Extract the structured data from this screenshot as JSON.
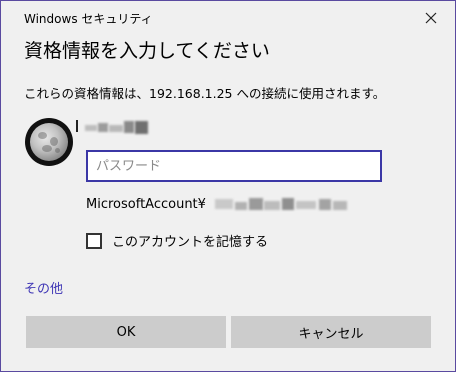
{
  "window": {
    "title": "Windows セキュリティ"
  },
  "dialog": {
    "heading": "資格情報を入力してください",
    "message": "これらの資格情報は、192.168.1.25 への接続に使用されます。",
    "password_placeholder": "パスワード",
    "password_value": "",
    "account_prefix": "MicrosoftAccount¥",
    "remember_label": "このアカウントを記憶する",
    "remember_checked": false,
    "other_link": "その他",
    "ok_label": "OK",
    "cancel_label": "キャンセル"
  },
  "icons": {
    "close": "close-icon",
    "avatar": "moon-avatar"
  },
  "colors": {
    "accent": "#3b37a6",
    "link": "#3f36b5",
    "button_bg": "#cccccc",
    "dialog_bg": "#f0f0f0",
    "window_border": "#5a4aa0"
  }
}
